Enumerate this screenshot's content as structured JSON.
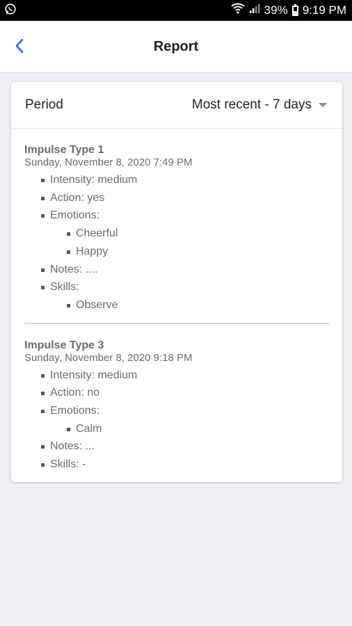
{
  "status_bar": {
    "battery_percent": "39%",
    "time": "9:19 PM"
  },
  "header": {
    "title": "Report"
  },
  "period": {
    "label": "Period",
    "selected": "Most recent - 7 days"
  },
  "entries": [
    {
      "title": "Impulse Type 1",
      "date": "Sunday, November 8, 2020 7:49 PM",
      "intensity": "Intensity: medium",
      "action": "Action: yes",
      "emotions_label": "Emotions:",
      "emotions": [
        "Cheerful",
        "Happy"
      ],
      "notes": "Notes: ....",
      "skills_label": "Skills:",
      "skills": [
        "Observe"
      ]
    },
    {
      "title": "Impulse Type 3",
      "date": "Sunday, November 8, 2020 9:18 PM",
      "intensity": "Intensity: medium",
      "action": "Action: no",
      "emotions_label": "Emotions:",
      "emotions": [
        "Calm"
      ],
      "notes": "Notes: ...",
      "skills_label": "Skills: -"
    }
  ],
  "colors": {
    "accent": "#1a73e8",
    "text_muted": "#6b6b6b",
    "background": "#eef0f3"
  }
}
